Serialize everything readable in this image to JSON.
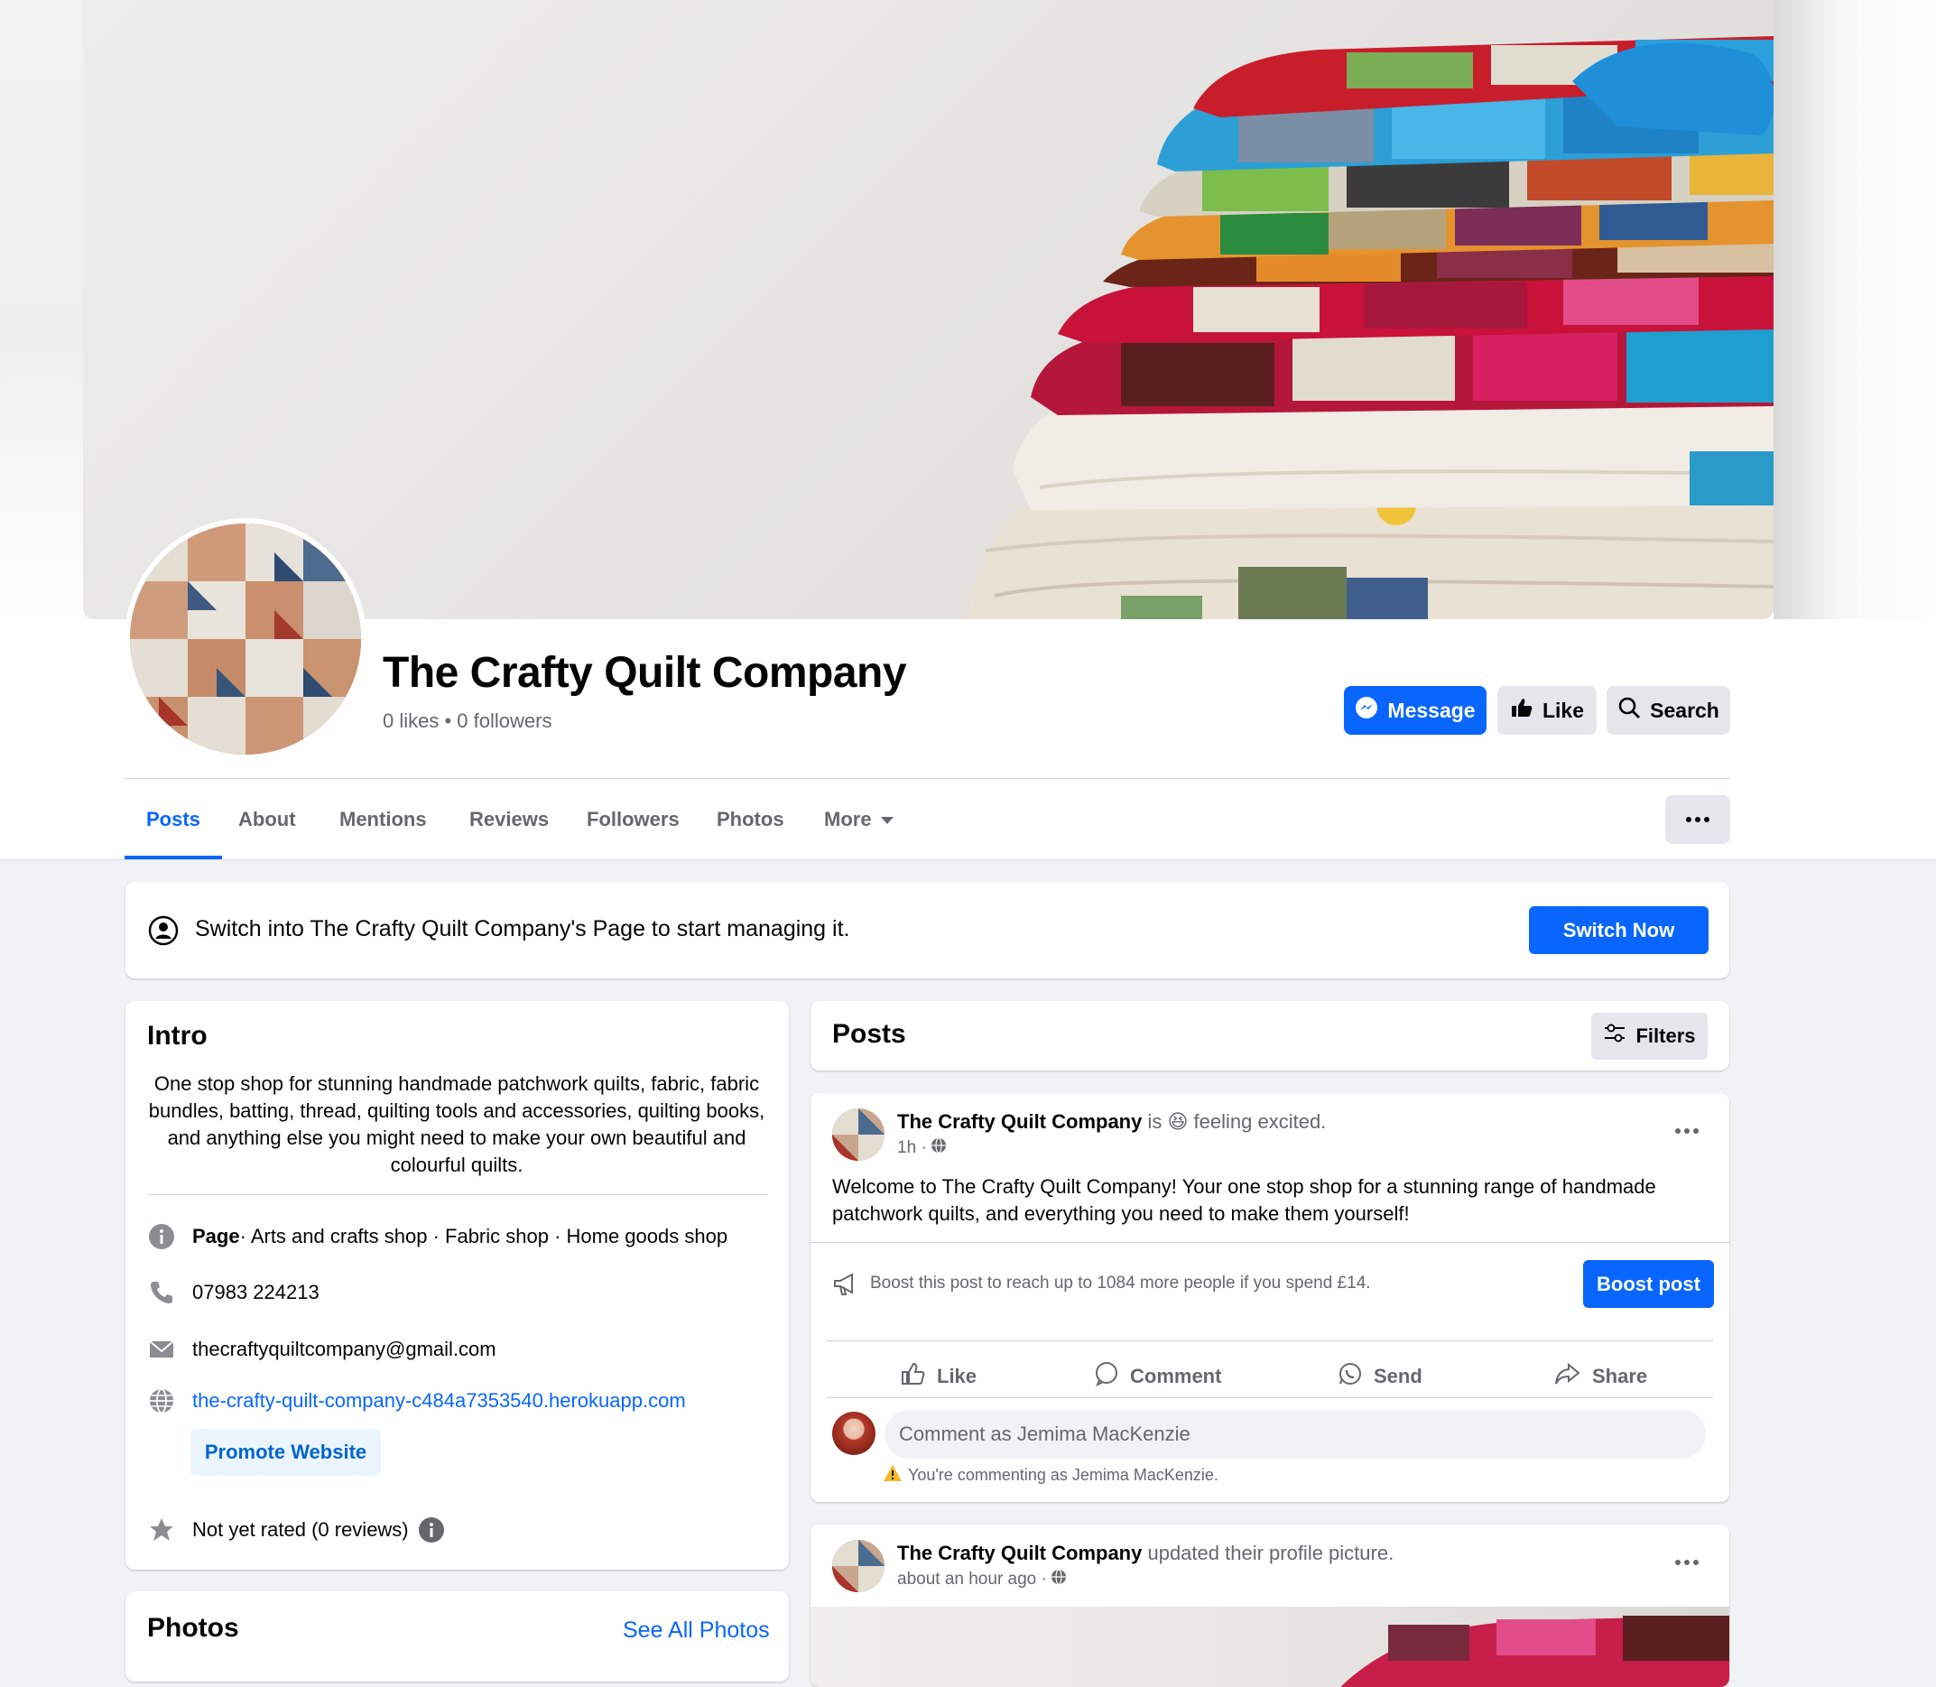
{
  "page": {
    "name": "The Crafty Quilt Company",
    "stats": "0 likes • 0 followers"
  },
  "header_buttons": {
    "message": "Message",
    "like": "Like",
    "search": "Search"
  },
  "tabs": [
    "Posts",
    "About",
    "Mentions",
    "Reviews",
    "Followers",
    "Photos",
    "More"
  ],
  "switch_banner": {
    "text": "Switch into The Crafty Quilt Company's Page to start managing it.",
    "button": "Switch Now"
  },
  "intro": {
    "title": "Intro",
    "description": "One stop shop for stunning handmade patchwork quilts, fabric, fabric bundles, batting, thread, quilting tools and accessories, quilting books, and anything else you might need to make your own beautiful and colourful quilts.",
    "category_label": "Page",
    "categories": " · Arts and crafts shop · Fabric shop · Home goods shop",
    "phone": "07983 224213",
    "email": "thecraftyquiltcompany@gmail.com",
    "website": "the-crafty-quilt-company-c484a7353540.herokuapp.com",
    "promote_button": "Promote Website",
    "rating": "Not yet rated (0 reviews)"
  },
  "photos_section": {
    "title": "Photos",
    "see_all": "See All Photos"
  },
  "posts_section": {
    "title": "Posts",
    "filters": "Filters"
  },
  "post1": {
    "author": "The Crafty Quilt Company",
    "status_is": " is ",
    "status_emoji": "😆",
    "status_feeling": " feeling excited.",
    "time": "1h ·",
    "body": "Welcome to The Crafty Quilt Company! Your one stop shop for a stunning range of handmade patchwork quilts, and everything you need to make them yourself!",
    "boost_text": "Boost this post to reach up to 1084 more people if you spend £14.",
    "boost_button": "Boost post",
    "actions": {
      "like": "Like",
      "comment": "Comment",
      "send": "Send",
      "share": "Share"
    },
    "comment_placeholder": "Comment as Jemima MacKenzie",
    "comment_note": "You're commenting as Jemima MacKenzie."
  },
  "post2": {
    "author": "The Crafty Quilt Company",
    "action": " updated their profile picture.",
    "time": "about an hour ago ·"
  },
  "colors": {
    "accent": "#0866ff",
    "background": "#f0f2f5",
    "secondary_text": "#65676b"
  }
}
